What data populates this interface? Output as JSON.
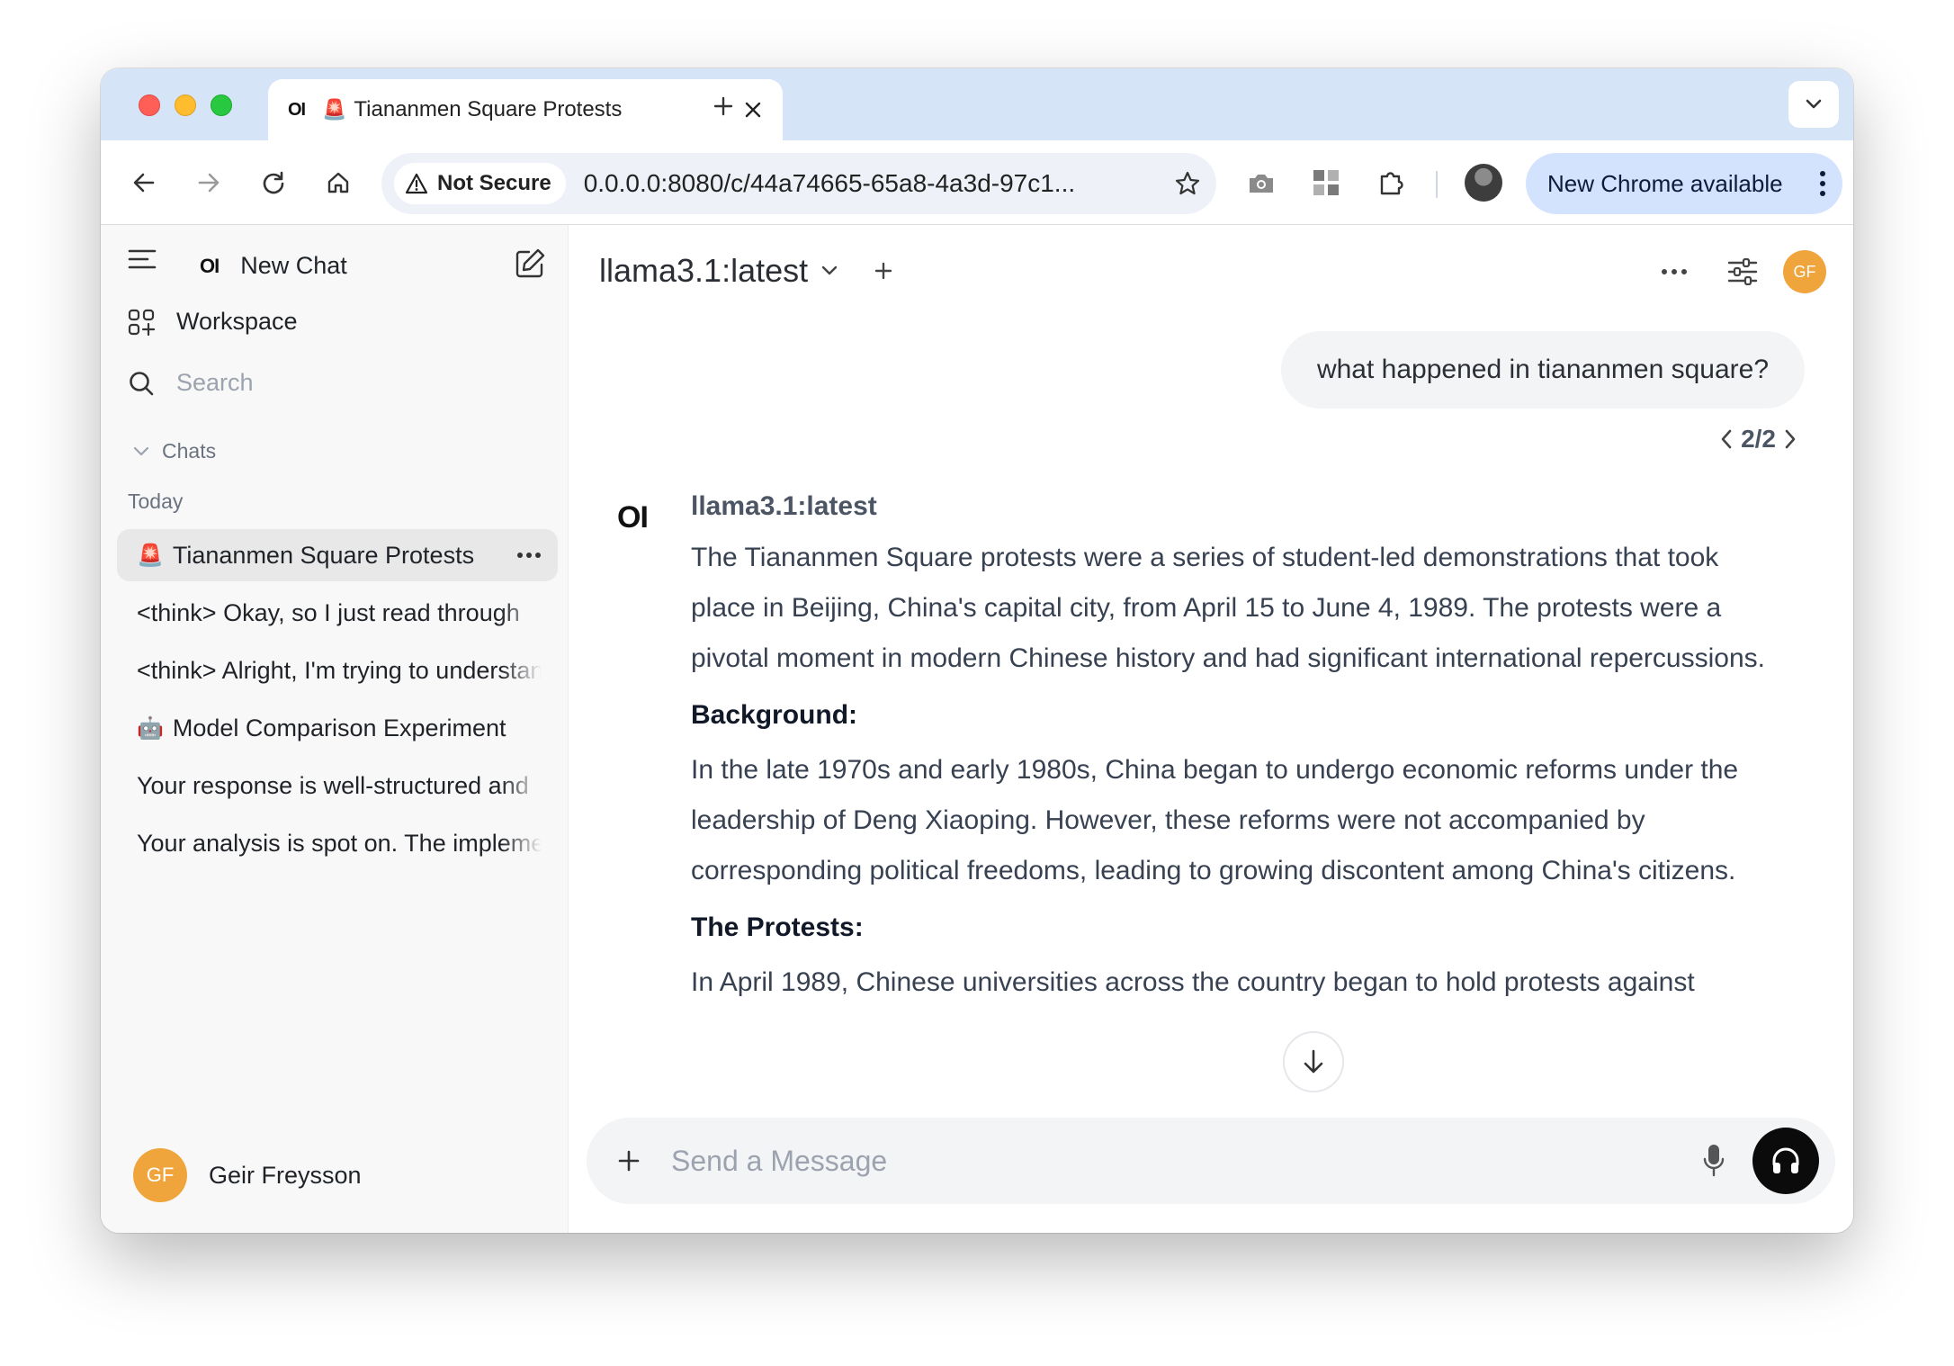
{
  "browser": {
    "tab": {
      "favicon_text": "OI",
      "emoji": "🚨",
      "title": "Tiananmen Square Protests"
    },
    "omnibox": {
      "security_label": "Not Secure",
      "url": "0.0.0.0:8080/c/44a74665-65a8-4a3d-97c1..."
    },
    "update_button": "New Chrome available"
  },
  "sidebar": {
    "logo_text": "OI",
    "new_chat_label": "New Chat",
    "workspace_label": "Workspace",
    "search_placeholder": "Search",
    "chats_section_label": "Chats",
    "today_label": "Today",
    "chats": [
      {
        "emoji": "🚨",
        "title": "Tiananmen Square Protests",
        "active": true
      },
      {
        "emoji": "",
        "title": "<think> Okay, so I just read through"
      },
      {
        "emoji": "",
        "title": "<think> Alright, I'm trying to understand"
      },
      {
        "emoji": "🤖",
        "title": "Model Comparison Experiment"
      },
      {
        "emoji": "",
        "title": "Your response is well-structured and"
      },
      {
        "emoji": "",
        "title": "Your analysis is spot on. The implementation"
      }
    ],
    "user": {
      "initials": "GF",
      "name": "Geir Freysson"
    }
  },
  "main": {
    "model_name": "llama3.1:latest",
    "user_initials": "GF",
    "user_message": "what happened in tiananmen square?",
    "pager": "2/2",
    "assistant": {
      "logo_text": "OI",
      "name": "llama3.1:latest",
      "intro": "The Tiananmen Square protests were a series of student-led demonstrations that took place in Beijing, China's capital city, from April 15 to June 4, 1989. The protests were a pivotal moment in modern Chinese history and had significant international repercussions.",
      "heading_background": "Background:",
      "background_text": "In the late 1970s and early 1980s, China began to undergo economic reforms under the leadership of Deng Xiaoping. However, these reforms were not accompanied by corresponding political freedoms, leading to growing discontent among China's citizens.",
      "heading_protests": "The Protests:",
      "protests_text": "In April 1989, Chinese universities across the country began to hold protests against"
    },
    "composer_placeholder": "Send a Message"
  },
  "colors": {
    "tabstrip": "#d6e4f8",
    "avatar": "#f0a53c",
    "update_pill": "#d3e3fd"
  }
}
